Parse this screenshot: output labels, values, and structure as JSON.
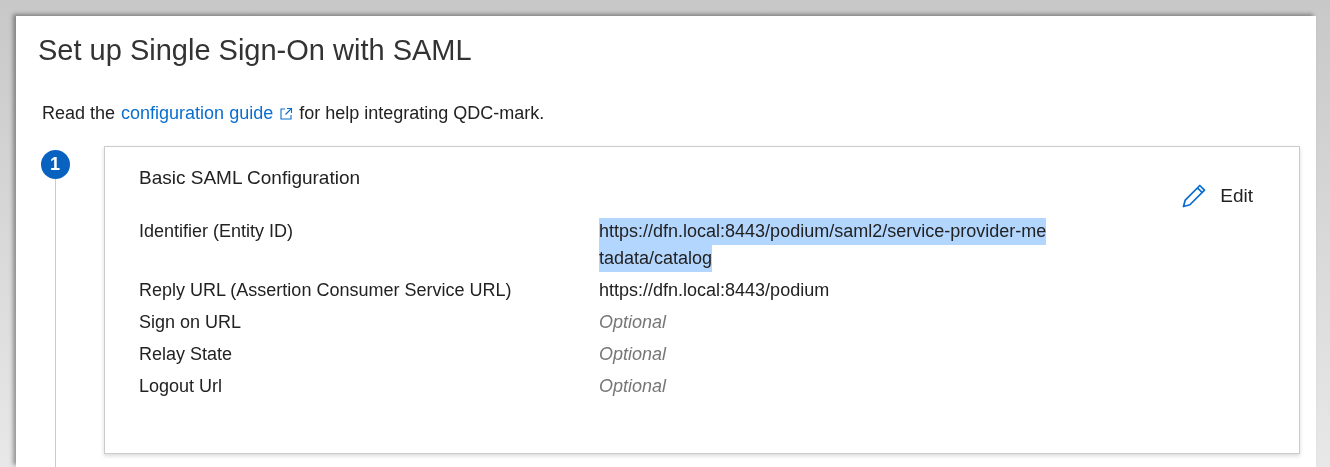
{
  "page": {
    "title": "Set up Single Sign-On with SAML"
  },
  "intro": {
    "before": "Read the",
    "link": "configuration guide",
    "after": "for help integrating QDC-mark."
  },
  "step": {
    "number": "1",
    "title": "Basic SAML Configuration",
    "edit": "Edit",
    "fields": [
      {
        "label": "Identifier (Entity ID)",
        "kind": "value",
        "selected": true,
        "lines": [
          "https://dfn.local:8443/podium/saml2/service-provider-me",
          "tadata/catalog"
        ]
      },
      {
        "label": "Reply URL (Assertion Consumer Service URL)",
        "kind": "value",
        "selected": false,
        "lines": [
          "https://dfn.local:8443/podium"
        ]
      },
      {
        "label": "Sign on URL",
        "kind": "placeholder",
        "selected": false,
        "lines": [
          "Optional"
        ]
      },
      {
        "label": "Relay State",
        "kind": "placeholder",
        "selected": false,
        "lines": [
          "Optional"
        ]
      },
      {
        "label": "Logout Url",
        "kind": "placeholder",
        "selected": false,
        "lines": [
          "Optional"
        ]
      }
    ]
  }
}
